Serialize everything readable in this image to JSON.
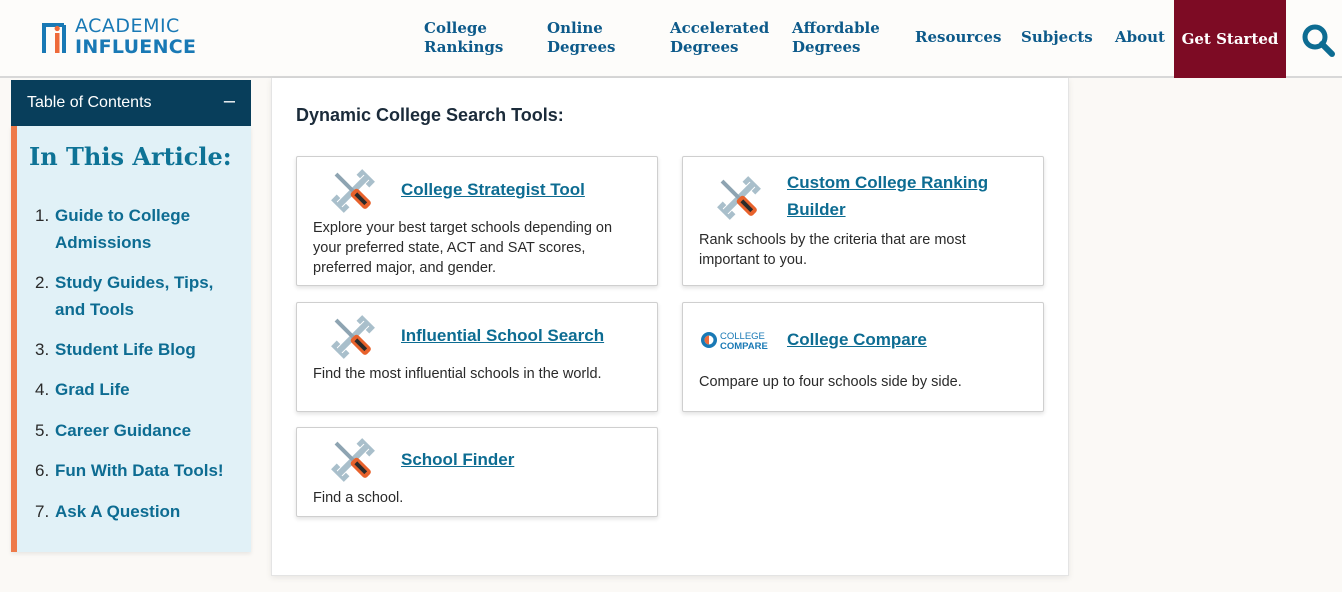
{
  "brand": {
    "logo_line1": "ACADEMIC",
    "logo_line2": "INFLUENCE",
    "colors": {
      "nav": "#0d5a8a",
      "cta": "#7d0b24",
      "toc_header": "#083e5b",
      "toc_accent": "#ee7a4a",
      "link": "#0d6c92"
    }
  },
  "nav": {
    "items": [
      {
        "label_1": "College",
        "label_2": "Rankings"
      },
      {
        "label_1": "Online",
        "label_2": "Degrees"
      },
      {
        "label_1": "Accelerated",
        "label_2": "Degrees"
      },
      {
        "label_1": "Affordable",
        "label_2": "Degrees"
      },
      {
        "label": "Resources"
      },
      {
        "label": "Subjects"
      },
      {
        "label": "About"
      }
    ],
    "cta": "Get Started",
    "search_icon": "search-icon"
  },
  "toc": {
    "header": "Table of Contents",
    "toggle": "–",
    "title": "In This Article:",
    "items": [
      {
        "num": "1.",
        "label": "Guide to College Admissions"
      },
      {
        "num": "2.",
        "label": "Study Guides, Tips, and Tools"
      },
      {
        "num": "3.",
        "label": "Student Life Blog"
      },
      {
        "num": "4.",
        "label": "Grad Life"
      },
      {
        "num": "5.",
        "label": "Career Guidance"
      },
      {
        "num": "6.",
        "label": "Fun With Data Tools!"
      },
      {
        "num": "7.",
        "label": "Ask A Question"
      }
    ]
  },
  "main": {
    "title": "Dynamic College Search Tools:",
    "cards": [
      {
        "icon": "tools-icon",
        "title": "College Strategist Tool",
        "desc": "Explore your best target schools depending on your preferred state, ACT and SAT scores, preferred major, and gender."
      },
      {
        "icon": "tools-icon",
        "title": "Custom College Ranking Builder",
        "desc": "Rank schools by the criteria that are most important to you."
      },
      {
        "icon": "tools-icon",
        "title": "Influential School Search",
        "desc": "Find the most influential schools in the world."
      },
      {
        "icon": "college-compare-logo",
        "logo_line1": "COLLEGE",
        "logo_line2": "COMPARE",
        "title": "College Compare",
        "desc": "Compare up to four schools side by side."
      },
      {
        "icon": "tools-icon",
        "title": "School Finder",
        "desc": "Find a school."
      }
    ]
  }
}
